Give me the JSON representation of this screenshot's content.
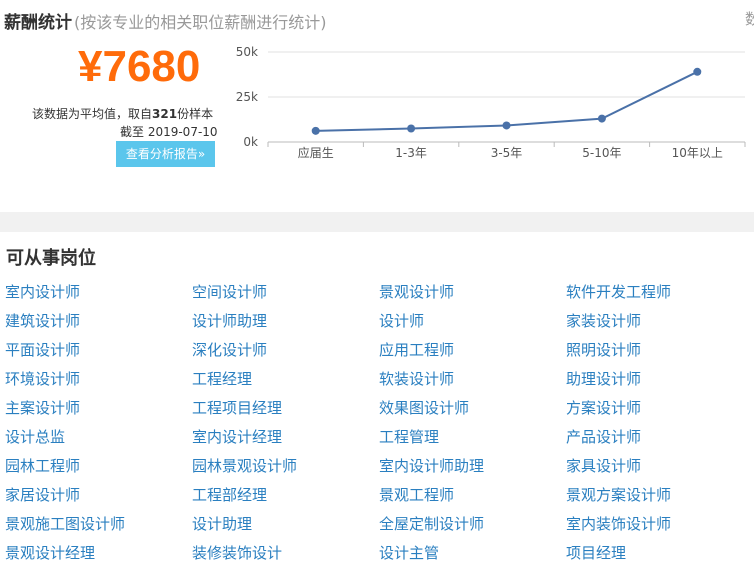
{
  "header": {
    "title": "薪酬统计",
    "subtitle": "(按该专业的相关职位薪酬进行统计)",
    "edge_glyph": "数"
  },
  "salary": {
    "value": "¥7680",
    "note_prefix": "该数据为平均值，取自",
    "sample_count": "321",
    "note_suffix": "份样本",
    "date_label": "截至 2019-07-10",
    "report_button": "查看分析报告»",
    "accent_color": "#ff6b0a",
    "button_color": "#5bc6ec"
  },
  "chart_data": {
    "type": "line",
    "categories": [
      "应届生",
      "1-3年",
      "3-5年",
      "5-10年",
      "10年以上"
    ],
    "values": [
      6200,
      7500,
      9200,
      13000,
      39000
    ],
    "y_ticks": [
      "0k",
      "25k",
      "50k"
    ],
    "ylim": [
      0,
      50000
    ],
    "grid": true,
    "line_color": "#4a71a8"
  },
  "jobs": {
    "title": "可从事岗位",
    "link_color": "#2a7fc0",
    "rows": [
      [
        "室内设计师",
        "空间设计师",
        "景观设计师",
        "软件开发工程师"
      ],
      [
        "建筑设计师",
        "设计师助理",
        "设计师",
        "家装设计师"
      ],
      [
        "平面设计师",
        "深化设计师",
        "应用工程师",
        "照明设计师"
      ],
      [
        "环境设计师",
        "工程经理",
        "软装设计师",
        "助理设计师"
      ],
      [
        "主案设计师",
        "工程项目经理",
        "效果图设计师",
        "方案设计师"
      ],
      [
        "设计总监",
        "室内设计经理",
        "工程管理",
        "产品设计师"
      ],
      [
        "园林工程师",
        "园林景观设计师",
        "室内设计师助理",
        "家具设计师"
      ],
      [
        "家居设计师",
        "工程部经理",
        "景观工程师",
        "景观方案设计师"
      ],
      [
        "景观施工图设计师",
        "设计助理",
        "全屋定制设计师",
        "室内装饰设计师"
      ],
      [
        "景观设计经理",
        "装修装饰设计",
        "设计主管",
        "项目经理"
      ]
    ]
  }
}
